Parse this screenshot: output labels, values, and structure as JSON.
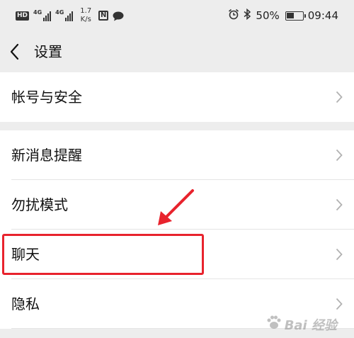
{
  "status_bar": {
    "hd": "HD",
    "net1": "4G",
    "net2": "4G",
    "speed_value": "1.7",
    "speed_unit": "K/s",
    "nfc": "N",
    "battery": "50%",
    "battery_level": 0.5,
    "time": "09:44"
  },
  "nav": {
    "title": "设置"
  },
  "groups": [
    {
      "items": [
        "帐号与安全"
      ]
    },
    {
      "items": [
        "新消息提醒",
        "勿扰模式",
        "聊天",
        "隐私"
      ]
    }
  ],
  "watermark": {
    "text": "Bai 经验"
  },
  "colors": {
    "background": "#ededed",
    "card": "#ffffff",
    "annotation": "#e8232d",
    "chevron": "#b2b2b2"
  }
}
